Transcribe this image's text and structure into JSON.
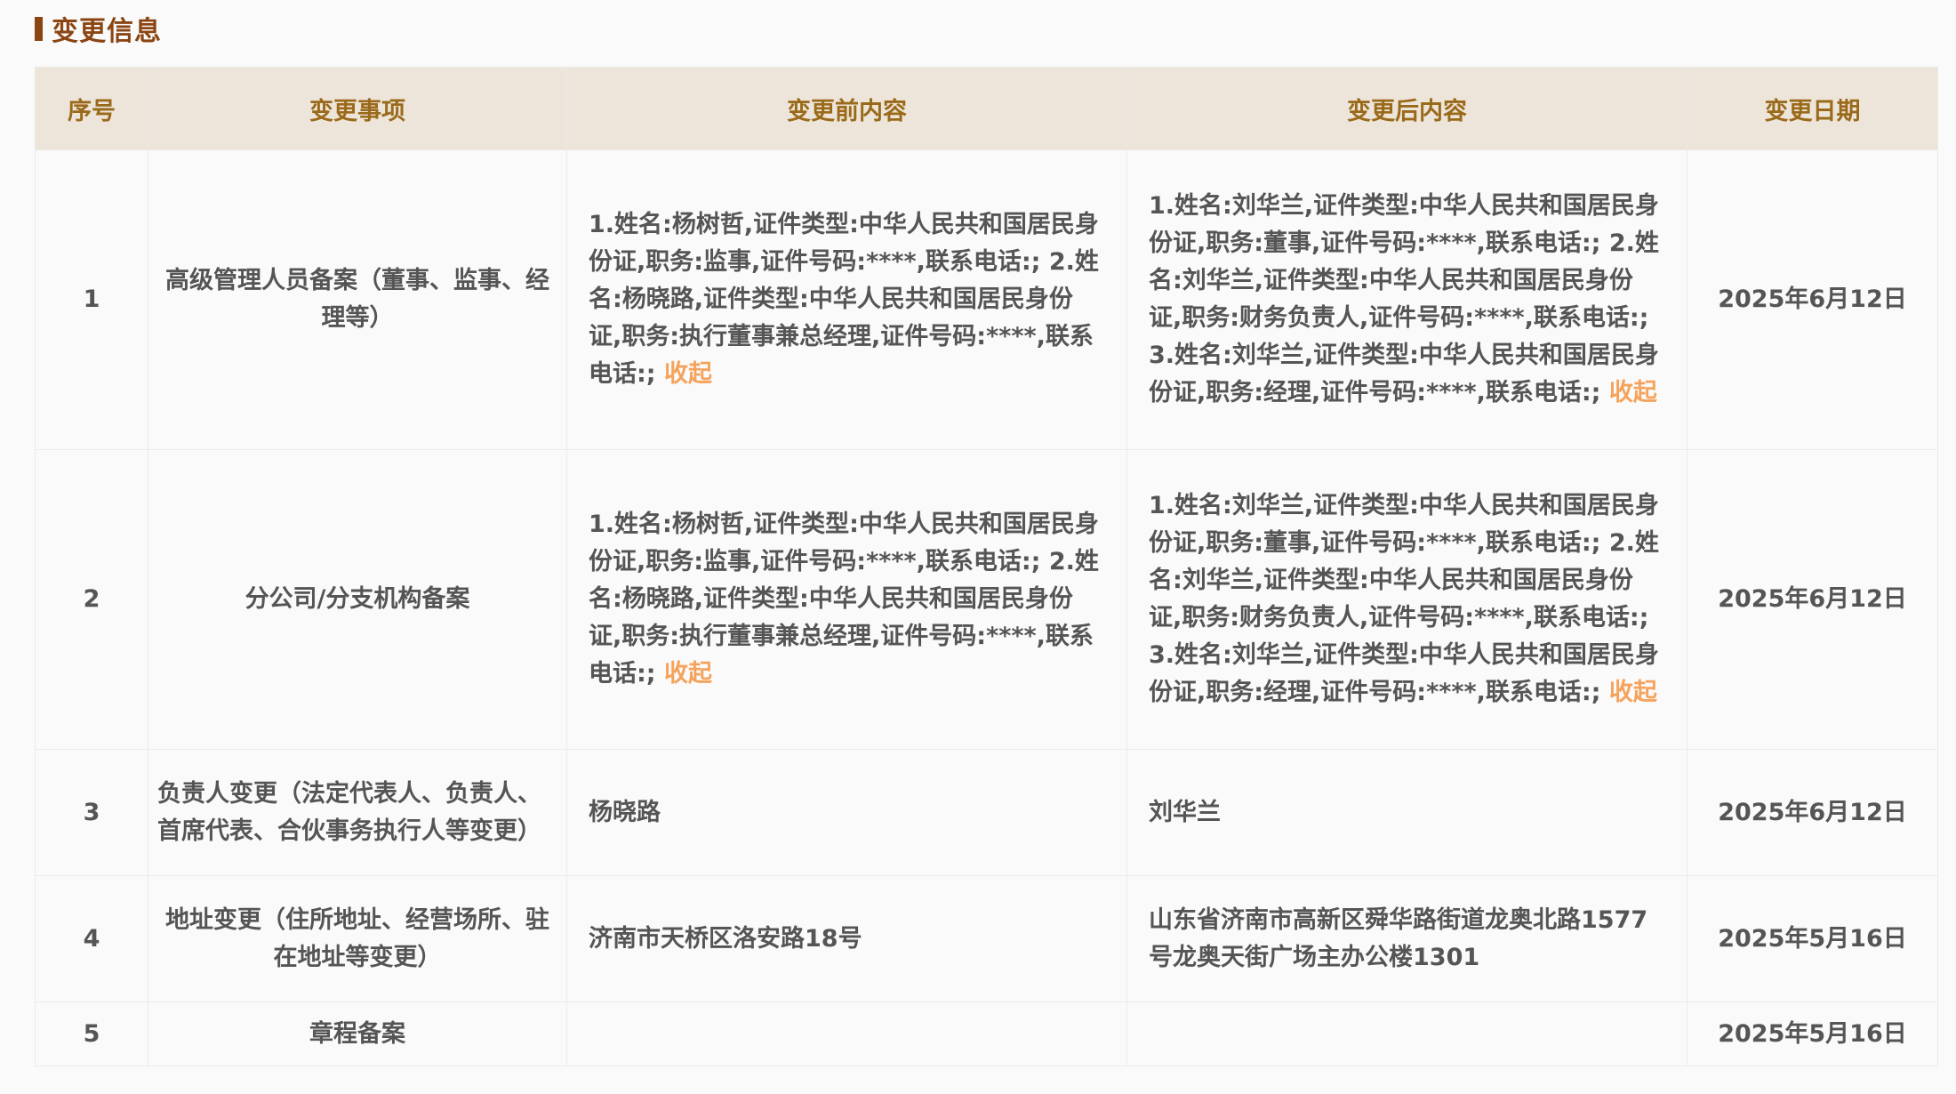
{
  "section": {
    "title": "变更信息"
  },
  "table": {
    "headers": {
      "seq": "序号",
      "item": "变更事项",
      "before": "变更前内容",
      "after": "变更后内容",
      "date": "变更日期"
    },
    "collapse_label": "收起",
    "rows": [
      {
        "seq": "1",
        "item": "高级管理人员备案（董事、监事、经理等）",
        "before": "1.姓名:杨树哲,证件类型:中华人民共和国居民身份证,职务:监事,证件号码:****,联系电话:; 2.姓名:杨晓路,证件类型:中华人民共和国居民身份证,职务:执行董事兼总经理,证件号码:****,联系电话:;",
        "after": "1.姓名:刘华兰,证件类型:中华人民共和国居民身份证,职务:董事,证件号码:****,联系电话:; 2.姓名:刘华兰,证件类型:中华人民共和国居民身份证,职务:财务负责人,证件号码:****,联系电话:; 3.姓名:刘华兰,证件类型:中华人民共和国居民身份证,职务:经理,证件号码:****,联系电话:;",
        "date": "2025年6月12日"
      },
      {
        "seq": "2",
        "item": "分公司/分支机构备案",
        "before": "1.姓名:杨树哲,证件类型:中华人民共和国居民身份证,职务:监事,证件号码:****,联系电话:; 2.姓名:杨晓路,证件类型:中华人民共和国居民身份证,职务:执行董事兼总经理,证件号码:****,联系电话:;",
        "after": "1.姓名:刘华兰,证件类型:中华人民共和国居民身份证,职务:董事,证件号码:****,联系电话:; 2.姓名:刘华兰,证件类型:中华人民共和国居民身份证,职务:财务负责人,证件号码:****,联系电话:; 3.姓名:刘华兰,证件类型:中华人民共和国居民身份证,职务:经理,证件号码:****,联系电话:;",
        "date": "2025年6月12日"
      },
      {
        "seq": "3",
        "item": "负责人变更（法定代表人、负责人、首席代表、合伙事务执行人等变更）",
        "before": "杨晓路",
        "after": "刘华兰",
        "date": "2025年6月12日"
      },
      {
        "seq": "4",
        "item": "地址变更（住所地址、经营场所、驻在地址等变更）",
        "before": "济南市天桥区洛安路18号",
        "after": "山东省济南市高新区舜华路街道龙奥北路1577号龙奥天街广场主办公楼1301",
        "date": "2025年5月16日"
      },
      {
        "seq": "5",
        "item": "章程备案",
        "before": "",
        "after": "",
        "date": "2025年5月16日"
      }
    ]
  }
}
